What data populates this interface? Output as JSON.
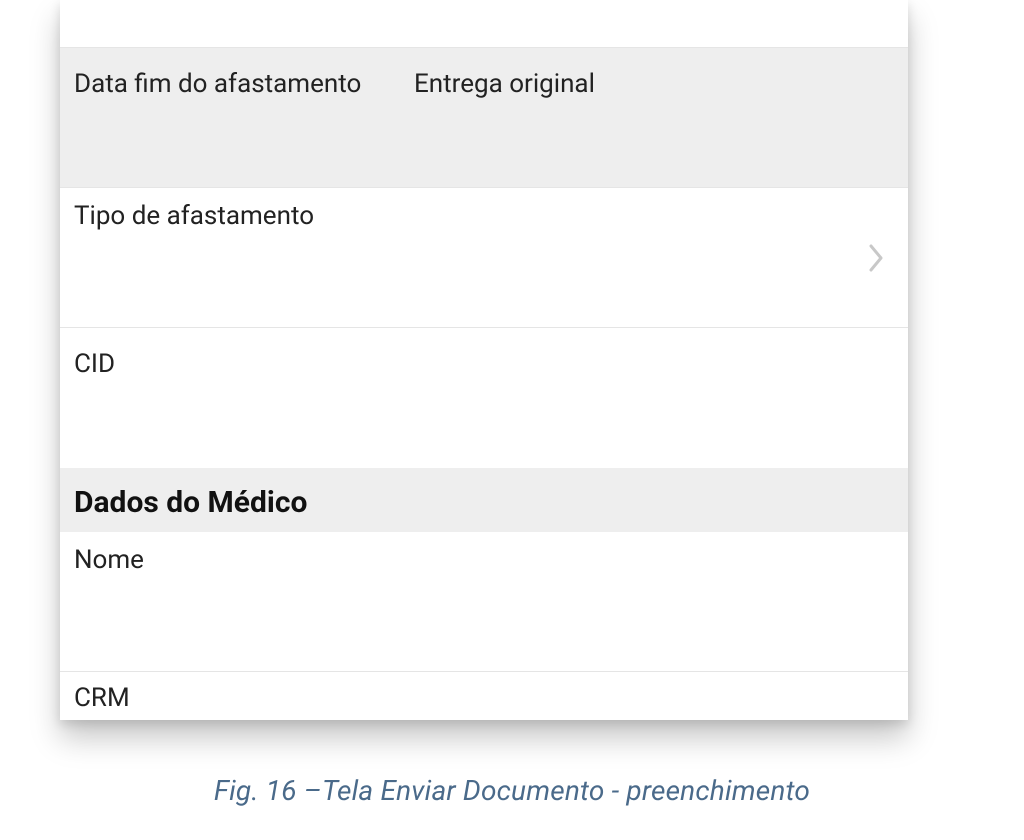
{
  "form": {
    "data_fim_afastamento_label": "Data fim do afastamento",
    "entrega_original_label": "Entrega original",
    "tipo_afastamento_label": "Tipo de afastamento",
    "cid_label": "CID"
  },
  "section_medico": {
    "header": "Dados do Médico",
    "nome_label": "Nome",
    "crm_label": "CRM"
  },
  "caption": "Fig. 16 –Tela Enviar Documento - preenchimento"
}
